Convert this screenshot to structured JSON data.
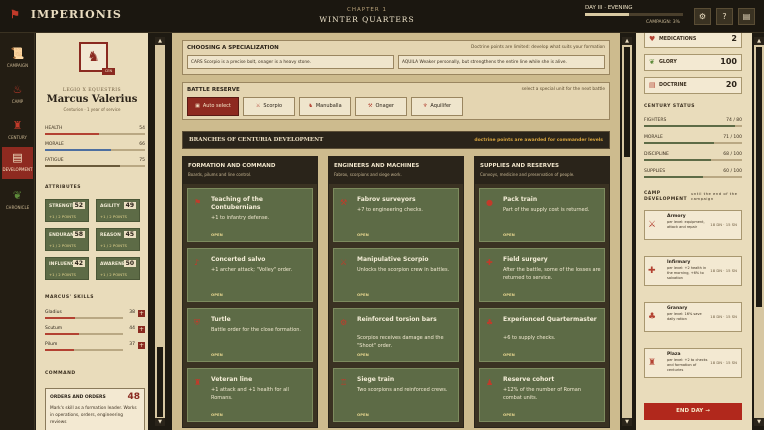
{
  "topbar": {
    "brand": "IMPERIONIS",
    "chapter": "CHAPTER 1",
    "chapter_title": "WINTER QUARTERS",
    "day": "DAY III · EVENING",
    "campaign": "CAMPAIGN: 3%",
    "day_progress": 0.45
  },
  "nav": [
    {
      "label": "CAMPAIGN",
      "icon": "scroll-icon"
    },
    {
      "label": "CAMP",
      "icon": "campfire-icon"
    },
    {
      "label": "CENTURY",
      "icon": "soldier-icon"
    },
    {
      "label": "DEVELOPMENT",
      "icon": "book-icon"
    },
    {
      "label": "CHRONICLE",
      "icon": "laurel-icon"
    }
  ],
  "hero": {
    "subtitle": "LEGIO X EQUESTRIS",
    "name": "Marcus Valerius",
    "meta": "Centurion · 1 year of service",
    "badge": "CEN"
  },
  "stats": [
    {
      "label": "HEALTH",
      "value": "54",
      "fill": 0.54,
      "color": "#b34232"
    },
    {
      "label": "MORALE",
      "value": "66",
      "fill": 0.66,
      "color": "#4e6fa0"
    },
    {
      "label": "FATIGUE",
      "value": "75",
      "fill": 0.75,
      "color": "#6a5a3a"
    }
  ],
  "attributes_title": "ATTRIBUTES",
  "attributes": [
    {
      "name": "STRENGTH",
      "value": "52",
      "sub": "+1 / 2 POINTS"
    },
    {
      "name": "AGILITY",
      "value": "49",
      "sub": "+1 / 2 POINTS"
    },
    {
      "name": "ENDURANCE",
      "value": "58",
      "sub": "+1 / 2 POINTS"
    },
    {
      "name": "REASON",
      "value": "45",
      "sub": "+1 / 2 POINTS"
    },
    {
      "name": "INFLUENCE",
      "value": "42",
      "sub": "+1 / 2 POINTS"
    },
    {
      "name": "AWARENESS",
      "value": "50",
      "sub": "+1 / 2 POINTS"
    }
  ],
  "skills_title": "MARCUS' SKILLS",
  "skills": [
    {
      "name": "Gladius",
      "value": "38",
      "fill": 0.38
    },
    {
      "name": "Scutum",
      "value": "44",
      "fill": 0.44
    },
    {
      "name": "Pilum",
      "value": "37",
      "fill": 0.37
    }
  ],
  "command_title": "COMMAND",
  "command": {
    "title": "ORDERS AND ORDERS",
    "value": "48",
    "desc": "Mark's skill as a formation leader. Works in operations, orders, engineering reviews"
  },
  "spec": {
    "title": "CHOOSING A SPECIALIZATION",
    "note": "Doctrine points are limited: develop what suits your formation",
    "opt1": "CARS Scorpio is a precise bolt, onager is a heavy stone.",
    "opt2": "AQUILA Weaker personally, but strengthens the entire line while she is alive."
  },
  "reserve": {
    "title": "BATTLE RESERVE",
    "note": "select a special unit for the next battle",
    "items": [
      {
        "label": "Auto select",
        "icon": "scroll-icon"
      },
      {
        "label": "Scorpio",
        "icon": "scorpio-icon"
      },
      {
        "label": "Manuballa",
        "icon": "horse-icon"
      },
      {
        "label": "Onager",
        "icon": "onager-icon"
      },
      {
        "label": "Aquilifer",
        "icon": "eagle-icon"
      }
    ]
  },
  "branches": {
    "title": "BRANCHES OF CENTURIA DEVELOPMENT",
    "note": "doctrine points are awarded for commander levels"
  },
  "columns": [
    {
      "title": "FORMATION AND COMMAND",
      "desc": "Boards, pilums and line control.",
      "cards": [
        {
          "icon": "standard-icon",
          "title": "Teaching of the Contubernians",
          "desc": "+1 to infantry defense.",
          "status": "OPEN"
        },
        {
          "icon": "horn-icon",
          "title": "Concerted salvo",
          "desc": "+1 archer attack; \"Volley\" order.",
          "status": "OPEN"
        },
        {
          "icon": "shield-icon",
          "title": "Turtle",
          "desc": "Battle order for the close formation.",
          "status": "OPEN"
        },
        {
          "icon": "helmet-icon",
          "title": "Veteran line",
          "desc": "+1 attack and +1 health for all Romans.",
          "status": "OPEN"
        }
      ]
    },
    {
      "title": "ENGINEERS AND MACHINES",
      "desc": "Fabrox, scorpions and siege work.",
      "cards": [
        {
          "icon": "hammer-icon",
          "title": "Fabrov surveyors",
          "desc": "+7 to engineering checks.",
          "status": "OPEN"
        },
        {
          "icon": "scorpio-icon",
          "title": "Manipulative Scorpio",
          "desc": "Unlocks the scorpion crew in battles.",
          "status": "OPEN"
        },
        {
          "icon": "gear-icon",
          "title": "Reinforced torsion bars",
          "desc": "Scorpios receives damage and the \"Shoot\" order.",
          "status": "OPEN"
        },
        {
          "icon": "tower-icon",
          "title": "Siege train",
          "desc": "Two scorpions and reinforced crews.",
          "status": "OPEN"
        }
      ]
    },
    {
      "title": "SUPPLIES AND RESERVES",
      "desc": "Convoys, medicine and preservation of people.",
      "cards": [
        {
          "icon": "apple-icon",
          "title": "Pack train",
          "desc": "Part of the supply cost is returned.",
          "status": "OPEN"
        },
        {
          "icon": "bandage-icon",
          "title": "Field surgery",
          "desc": "After the battle, some of the losses are returned to service.",
          "status": "OPEN"
        },
        {
          "icon": "grapes-icon",
          "title": "Experienced Quartermaster",
          "desc": "+6 to supply checks.",
          "status": "OPEN"
        },
        {
          "icon": "soldier-icon",
          "title": "Reserve cohort",
          "desc": "+12% of the number of Roman combat units.",
          "status": "OPEN"
        }
      ]
    }
  ],
  "resources": [
    {
      "name": "MEDICATIONS",
      "value": "2",
      "icon": "potion-icon",
      "color": "#b34232"
    },
    {
      "name": "GLORY",
      "value": "100",
      "icon": "laurel-icon",
      "color": "#5d8a3a"
    },
    {
      "name": "DOCTRINE",
      "value": "20",
      "icon": "book-icon",
      "color": "#b34232"
    }
  ],
  "century_title": "CENTURY STATUS",
  "century": [
    {
      "label": "FIGHTERS",
      "value": "74 / 80",
      "fill": 0.925
    },
    {
      "label": "MORALE",
      "value": "71 / 100",
      "fill": 0.71
    },
    {
      "label": "DISCIPLINE",
      "value": "68 / 100",
      "fill": 0.68
    },
    {
      "label": "SUPPLIES",
      "value": "60 / 100",
      "fill": 0.6
    }
  ],
  "camp_title": "CAMP DEVELOPMENT",
  "camp_note": "until the end of the campaign",
  "buildings": [
    {
      "icon": "armory-icon",
      "title": "Armory",
      "desc": "per level: equipment, attack and repair",
      "cost": "18 DN · 15 SN"
    },
    {
      "icon": "infirmary-icon",
      "title": "Infirmary",
      "desc": "per level: +2 health in the morning, +6% to salvation",
      "cost": "18 DN · 15 SN"
    },
    {
      "icon": "granary-icon",
      "title": "Granary",
      "desc": "per level: 16% save daily ration",
      "cost": "18 DN · 15 SN"
    },
    {
      "icon": "plaza-icon",
      "title": "Plaza",
      "desc": "per level: +2 to checks and formation of centuries",
      "cost": "18 DN · 15 SN"
    }
  ],
  "endday": "END DAY →"
}
